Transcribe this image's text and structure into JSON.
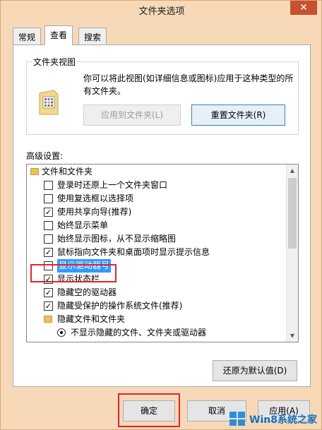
{
  "window": {
    "title": "文件夹选项",
    "close_label": "✕"
  },
  "tabs": [
    {
      "label": "常规",
      "active": false
    },
    {
      "label": "查看",
      "active": true
    },
    {
      "label": "搜索",
      "active": false
    }
  ],
  "folder_view": {
    "group_label": "文件夹视图",
    "description": "你可以将此视图(如详细信息或图标)应用于这种类型的所有文件夹。",
    "apply_button": "应用到文件夹(L)",
    "reset_button": "重置文件夹(R)"
  },
  "advanced": {
    "label": "高级设置:",
    "items": [
      {
        "type": "folder",
        "label": "文件和文件夹"
      },
      {
        "type": "checkbox",
        "label": "登录时还原上一个文件夹窗口",
        "checked": false
      },
      {
        "type": "checkbox",
        "label": "使用复选框以选择项",
        "checked": false
      },
      {
        "type": "checkbox",
        "label": "使用共享向导(推荐)",
        "checked": true
      },
      {
        "type": "checkbox",
        "label": "始终显示菜单",
        "checked": false
      },
      {
        "type": "checkbox",
        "label": "始终显示图标，从不显示缩略图",
        "checked": false
      },
      {
        "type": "checkbox",
        "label": "鼠标指向文件夹和桌面项时显示提示信息",
        "checked": true
      },
      {
        "type": "checkbox",
        "label": "显示驱动器号",
        "checked": false,
        "selected": true
      },
      {
        "type": "checkbox",
        "label": "显示状态栏",
        "checked": true
      },
      {
        "type": "checkbox",
        "label": "隐藏空的驱动器",
        "checked": true
      },
      {
        "type": "checkbox",
        "label": "隐藏受保护的操作系统文件(推荐)",
        "checked": true
      },
      {
        "type": "folder",
        "label": "隐藏文件和文件夹"
      },
      {
        "type": "radio",
        "label": "不显示隐藏的文件、文件夹或驱动器"
      }
    ],
    "restore_button": "还原为默认值(D)"
  },
  "footer": {
    "ok_button": "确定",
    "cancel_button": "取消",
    "apply_button": "应用(A)"
  },
  "watermark": {
    "text": "Win8系统之家"
  },
  "colors": {
    "window_frame": "#f7d9b8",
    "selection": "#3399ff",
    "annotation_red": "#e2242a",
    "close_button": "#c7502e"
  },
  "icons": {
    "folder_view": "folder-options-icon",
    "tree_folder": "folder-icon",
    "logo": "windows-logo-icon"
  }
}
